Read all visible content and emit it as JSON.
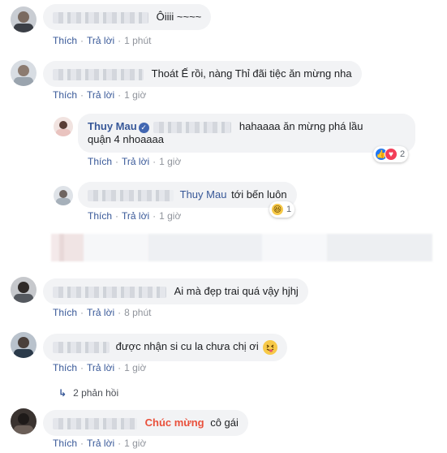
{
  "action_labels": {
    "like": "Thích",
    "reply": "Trả lời"
  },
  "comments": [
    {
      "text": "Ôiiii ~~~~",
      "time": "1 phút"
    },
    {
      "text": "Thoát Ế rồi, nàng Thỉ đãi tiệc ăn mừng nha",
      "time": "1 giờ"
    },
    {
      "author": "Thuy Mau",
      "text_line1": "hahaaaa ăn mừng phá lầu",
      "text_line2": "quận 4 nhoaaaa",
      "time": "1 giờ",
      "reaction_count": "2"
    },
    {
      "mention": "Thuy Mau",
      "text": "tới bến luôn",
      "time": "1 giờ",
      "reaction_count": "1"
    },
    {
      "text": "Ai mà đẹp trai quá vậy hjhj",
      "time": "8 phút"
    },
    {
      "text": "được nhận si cu la chưa chị ơi",
      "time": "1 giờ"
    },
    {
      "mention": "Chúc mừng",
      "text": "cô gái",
      "time": "1 giờ"
    }
  ],
  "replies_toggle": "2 phản hồi",
  "colors": {
    "link": "#385898",
    "bubble": "#f2f3f5",
    "mention_red": "#e9503b"
  }
}
